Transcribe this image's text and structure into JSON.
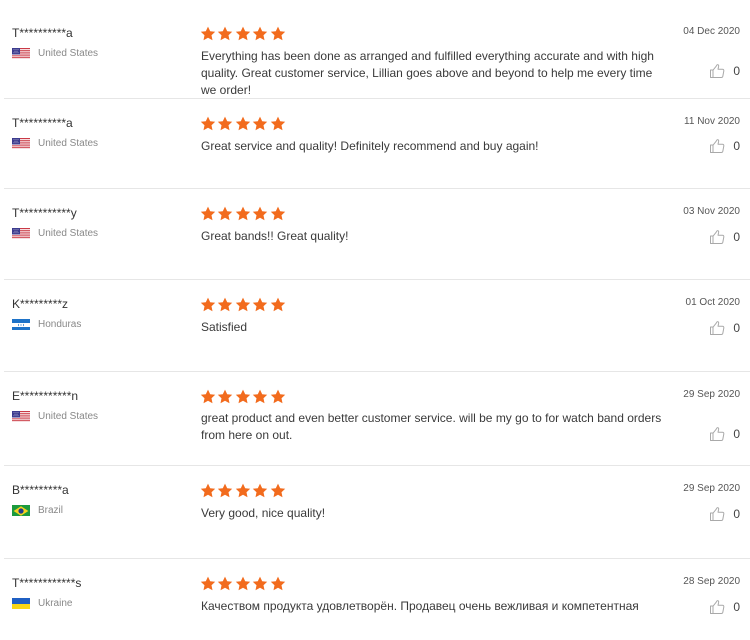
{
  "colors": {
    "star": "#f26b1d",
    "separator": "#e6e6e6",
    "country_text": "#888888"
  },
  "reviews": [
    {
      "user": "T**********a",
      "country": "United States",
      "flag": "us-flag",
      "rating": 5,
      "text": "Everything has been done as arranged and fulfilled everything accurate and with high quality. Great customer service, Lillian goes above and beyond to help me every time we order!",
      "date": "04 Dec 2020",
      "likes": "0"
    },
    {
      "user": "T**********a",
      "country": "United States",
      "flag": "us-flag",
      "rating": 5,
      "text": "Great service and quality! Definitely recommend and buy again!",
      "date": "11 Nov 2020",
      "likes": "0"
    },
    {
      "user": "T***********y",
      "country": "United States",
      "flag": "us-flag",
      "rating": 5,
      "text": "Great bands!! Great quality!",
      "date": "03 Nov 2020",
      "likes": "0"
    },
    {
      "user": "K*********z",
      "country": "Honduras",
      "flag": "honduras-flag",
      "rating": 5,
      "text": "Satisfied",
      "date": "01 Oct 2020",
      "likes": "0"
    },
    {
      "user": "E***********n",
      "country": "United States",
      "flag": "us-flag",
      "rating": 5,
      "text": "great product and even better customer service. will be my go to for watch band orders from here on out.",
      "date": "29 Sep 2020",
      "likes": "0"
    },
    {
      "user": "B*********a",
      "country": "Brazil",
      "flag": "brazil-flag",
      "rating": 5,
      "text": "Very good, nice quality!",
      "date": "29 Sep 2020",
      "likes": "0"
    },
    {
      "user": "T************s",
      "country": "Ukraine",
      "flag": "ukraine-flag",
      "rating": 5,
      "text": "Качеством продукта удовлетворён. Продавец очень вежливая и компетентная",
      "date": "28 Sep 2020",
      "likes": "0"
    }
  ]
}
